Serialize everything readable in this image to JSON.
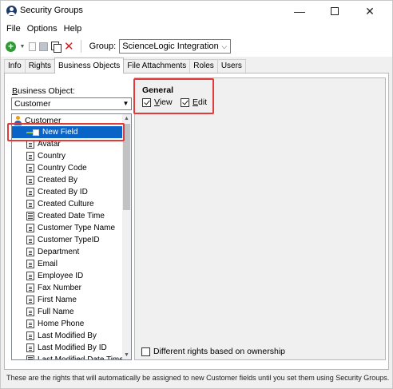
{
  "window": {
    "title": "Security Groups"
  },
  "menu": [
    "File",
    "Options",
    "Help"
  ],
  "toolbar": {
    "group_label": "Group:",
    "group_value": "ScienceLogic Integration"
  },
  "tabs": [
    "Info",
    "Rights",
    "Business Objects",
    "File Attachments",
    "Roles",
    "Users"
  ],
  "active_tab": "Business Objects",
  "business_object": {
    "label": "Business Object:",
    "value": "Customer"
  },
  "tree": {
    "root": "Customer",
    "items": [
      {
        "label": "New Field",
        "icon": "new-field-icon",
        "selected": true
      },
      {
        "label": "Avatar",
        "icon": "field-icon"
      },
      {
        "label": "Country",
        "icon": "field-icon"
      },
      {
        "label": "Country Code",
        "icon": "field-icon"
      },
      {
        "label": "Created By",
        "icon": "field-icon"
      },
      {
        "label": "Created By ID",
        "icon": "field-icon"
      },
      {
        "label": "Created Culture",
        "icon": "field-icon"
      },
      {
        "label": "Created Date Time",
        "icon": "datetime-field-icon"
      },
      {
        "label": "Customer Type Name",
        "icon": "field-icon"
      },
      {
        "label": "Customer TypeID",
        "icon": "field-icon"
      },
      {
        "label": "Department",
        "icon": "field-icon"
      },
      {
        "label": "Email",
        "icon": "field-icon"
      },
      {
        "label": "Employee ID",
        "icon": "field-icon"
      },
      {
        "label": "Fax Number",
        "icon": "field-icon"
      },
      {
        "label": "First Name",
        "icon": "field-icon"
      },
      {
        "label": "Full Name",
        "icon": "field-icon"
      },
      {
        "label": "Home Phone",
        "icon": "field-icon"
      },
      {
        "label": "Last Modified By",
        "icon": "field-icon"
      },
      {
        "label": "Last Modified By ID",
        "icon": "field-icon"
      },
      {
        "label": "Last Modified Date Time",
        "icon": "datetime-field-icon"
      }
    ]
  },
  "rights": {
    "section_title": "General",
    "view": {
      "label": "View",
      "checked": true
    },
    "edit": {
      "label": "Edit",
      "checked": true
    },
    "different_rights": {
      "label": "Different rights based on ownership",
      "checked": false
    }
  },
  "note": "These are the rights that will automatically be assigned to new Customer fields until you set them using Security Groups.",
  "colors": {
    "highlight": "#e03a3a",
    "selection": "#0a64c8"
  }
}
